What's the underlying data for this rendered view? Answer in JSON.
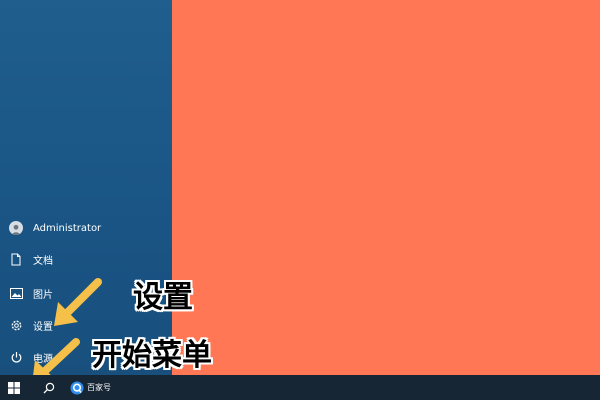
{
  "start_menu": {
    "items": [
      {
        "label": "Administrator",
        "icon": "user-avatar-icon"
      },
      {
        "label": "文档",
        "icon": "document-icon"
      },
      {
        "label": "图片",
        "icon": "picture-icon"
      },
      {
        "label": "设置",
        "icon": "gear-icon"
      },
      {
        "label": "电源",
        "icon": "power-icon"
      }
    ]
  },
  "taskbar": {
    "start_icon": "windows-logo-icon",
    "search_icon": "search-icon",
    "app_label": "百家号",
    "app_icon": "baijiahao-icon"
  },
  "annotations": {
    "settings_label": "设置",
    "start_menu_label": "开始菜单",
    "arrow_color": "#f5c04a"
  },
  "colors": {
    "start_panel": "#1a5585",
    "desktop": "#ff7755",
    "taskbar": "#172634"
  }
}
